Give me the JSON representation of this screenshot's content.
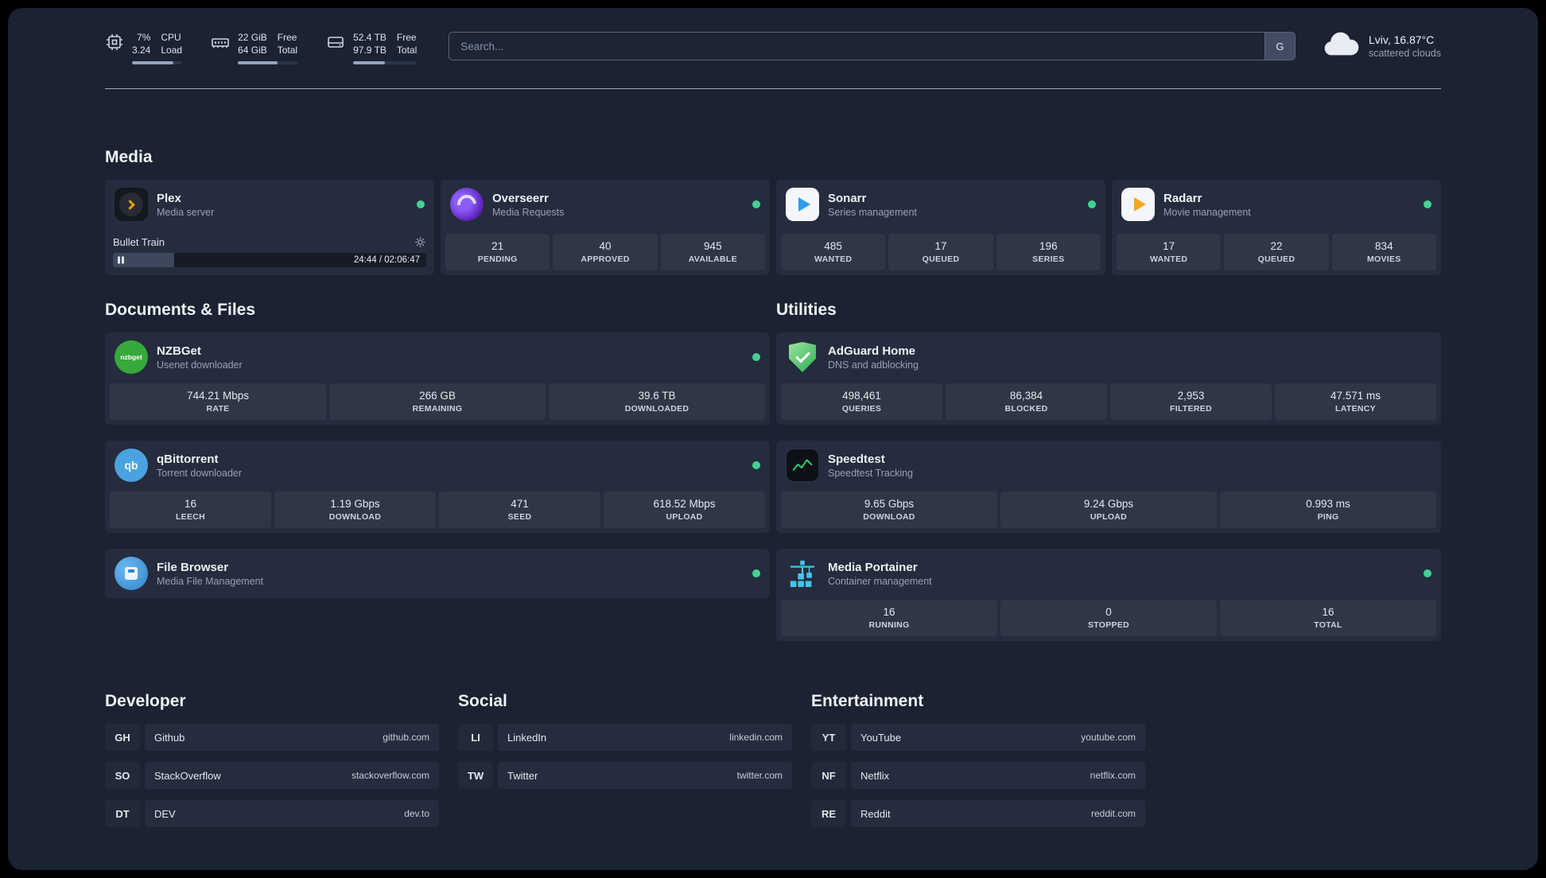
{
  "topbar": {
    "resources": [
      {
        "icon": "cpu-chip",
        "values": [
          "7%",
          "3.24"
        ],
        "labels": [
          "CPU",
          "Load"
        ],
        "progress": 82
      },
      {
        "icon": "memory",
        "values": [
          "22 GiB",
          "64 GiB"
        ],
        "labels": [
          "Free",
          "Total"
        ],
        "progress": 66
      },
      {
        "icon": "hard-drive",
        "values": [
          "52.4 TB",
          "97.9 TB"
        ],
        "labels": [
          "Free",
          "Total"
        ],
        "progress": 50
      }
    ],
    "search": {
      "placeholder": "Search...",
      "provider_label": "G"
    },
    "weather": {
      "icon": "cloud",
      "location": "Lviv, 16.87°C",
      "condition": "scattered clouds"
    }
  },
  "sections": {
    "media": {
      "title": "Media",
      "cards": [
        {
          "name": "Plex",
          "subtitle": "Media server",
          "status": "online",
          "icon": "plex",
          "player": {
            "track": "Bullet Train",
            "time": "24:44 / 02:06:47",
            "progress": 19.5
          }
        },
        {
          "name": "Overseerr",
          "subtitle": "Media Requests",
          "status": "online",
          "icon": "overseerr",
          "stats": [
            {
              "value": "21",
              "label": "PENDING"
            },
            {
              "value": "40",
              "label": "APPROVED"
            },
            {
              "value": "945",
              "label": "AVAILABLE"
            }
          ]
        },
        {
          "name": "Sonarr",
          "subtitle": "Series management",
          "status": "online",
          "icon": "sonarr",
          "stats": [
            {
              "value": "485",
              "label": "WANTED"
            },
            {
              "value": "17",
              "label": "QUEUED"
            },
            {
              "value": "196",
              "label": "SERIES"
            }
          ]
        },
        {
          "name": "Radarr",
          "subtitle": "Movie management",
          "status": "online",
          "icon": "radarr",
          "stats": [
            {
              "value": "17",
              "label": "WANTED"
            },
            {
              "value": "22",
              "label": "QUEUED"
            },
            {
              "value": "834",
              "label": "MOVIES"
            }
          ]
        }
      ]
    },
    "documents": {
      "title": "Documents & Files",
      "cards": [
        {
          "name": "NZBGet",
          "subtitle": "Usenet downloader",
          "status": "online",
          "icon": "nzbget",
          "stats": [
            {
              "value": "744.21 Mbps",
              "label": "RATE"
            },
            {
              "value": "266 GB",
              "label": "REMAINING"
            },
            {
              "value": "39.6 TB",
              "label": "DOWNLOADED"
            }
          ]
        },
        {
          "name": "qBittorrent",
          "subtitle": "Torrent downloader",
          "status": "online",
          "icon": "qbittorrent",
          "stats": [
            {
              "value": "16",
              "label": "LEECH"
            },
            {
              "value": "1.19 Gbps",
              "label": "DOWNLOAD"
            },
            {
              "value": "471",
              "label": "SEED"
            },
            {
              "value": "618.52 Mbps",
              "label": "UPLOAD"
            }
          ]
        },
        {
          "name": "File Browser",
          "subtitle": "Media File Management",
          "status": "online",
          "icon": "filebrowser",
          "stats": []
        }
      ]
    },
    "utilities": {
      "title": "Utilities",
      "cards": [
        {
          "name": "AdGuard Home",
          "subtitle": "DNS and adblocking",
          "icon": "adguard",
          "stats": [
            {
              "value": "498,461",
              "label": "QUERIES"
            },
            {
              "value": "86,384",
              "label": "BLOCKED"
            },
            {
              "value": "2,953",
              "label": "FILTERED"
            },
            {
              "value": "47.571 ms",
              "label": "LATENCY"
            }
          ]
        },
        {
          "name": "Speedtest",
          "subtitle": "Speedtest Tracking",
          "icon": "speedtest",
          "stats": [
            {
              "value": "9.65 Gbps",
              "label": "DOWNLOAD"
            },
            {
              "value": "9.24 Gbps",
              "label": "UPLOAD"
            },
            {
              "value": "0.993 ms",
              "label": "PING"
            }
          ]
        },
        {
          "name": "Media Portainer",
          "subtitle": "Container management",
          "status": "online",
          "icon": "portainer",
          "stats": [
            {
              "value": "16",
              "label": "RUNNING"
            },
            {
              "value": "0",
              "label": "STOPPED"
            },
            {
              "value": "16",
              "label": "TOTAL"
            }
          ]
        }
      ]
    },
    "bookmarks": [
      {
        "title": "Developer",
        "items": [
          {
            "abbr": "GH",
            "name": "Github",
            "url": "github.com"
          },
          {
            "abbr": "SO",
            "name": "StackOverflow",
            "url": "stackoverflow.com"
          },
          {
            "abbr": "DT",
            "name": "DEV",
            "url": "dev.to"
          }
        ]
      },
      {
        "title": "Social",
        "items": [
          {
            "abbr": "LI",
            "name": "LinkedIn",
            "url": "linkedin.com"
          },
          {
            "abbr": "TW",
            "name": "Twitter",
            "url": "twitter.com"
          }
        ]
      },
      {
        "title": "Entertainment",
        "items": [
          {
            "abbr": "YT",
            "name": "YouTube",
            "url": "youtube.com"
          },
          {
            "abbr": "NF",
            "name": "Netflix",
            "url": "netflix.com"
          },
          {
            "abbr": "RE",
            "name": "Reddit",
            "url": "reddit.com"
          }
        ]
      }
    ]
  }
}
